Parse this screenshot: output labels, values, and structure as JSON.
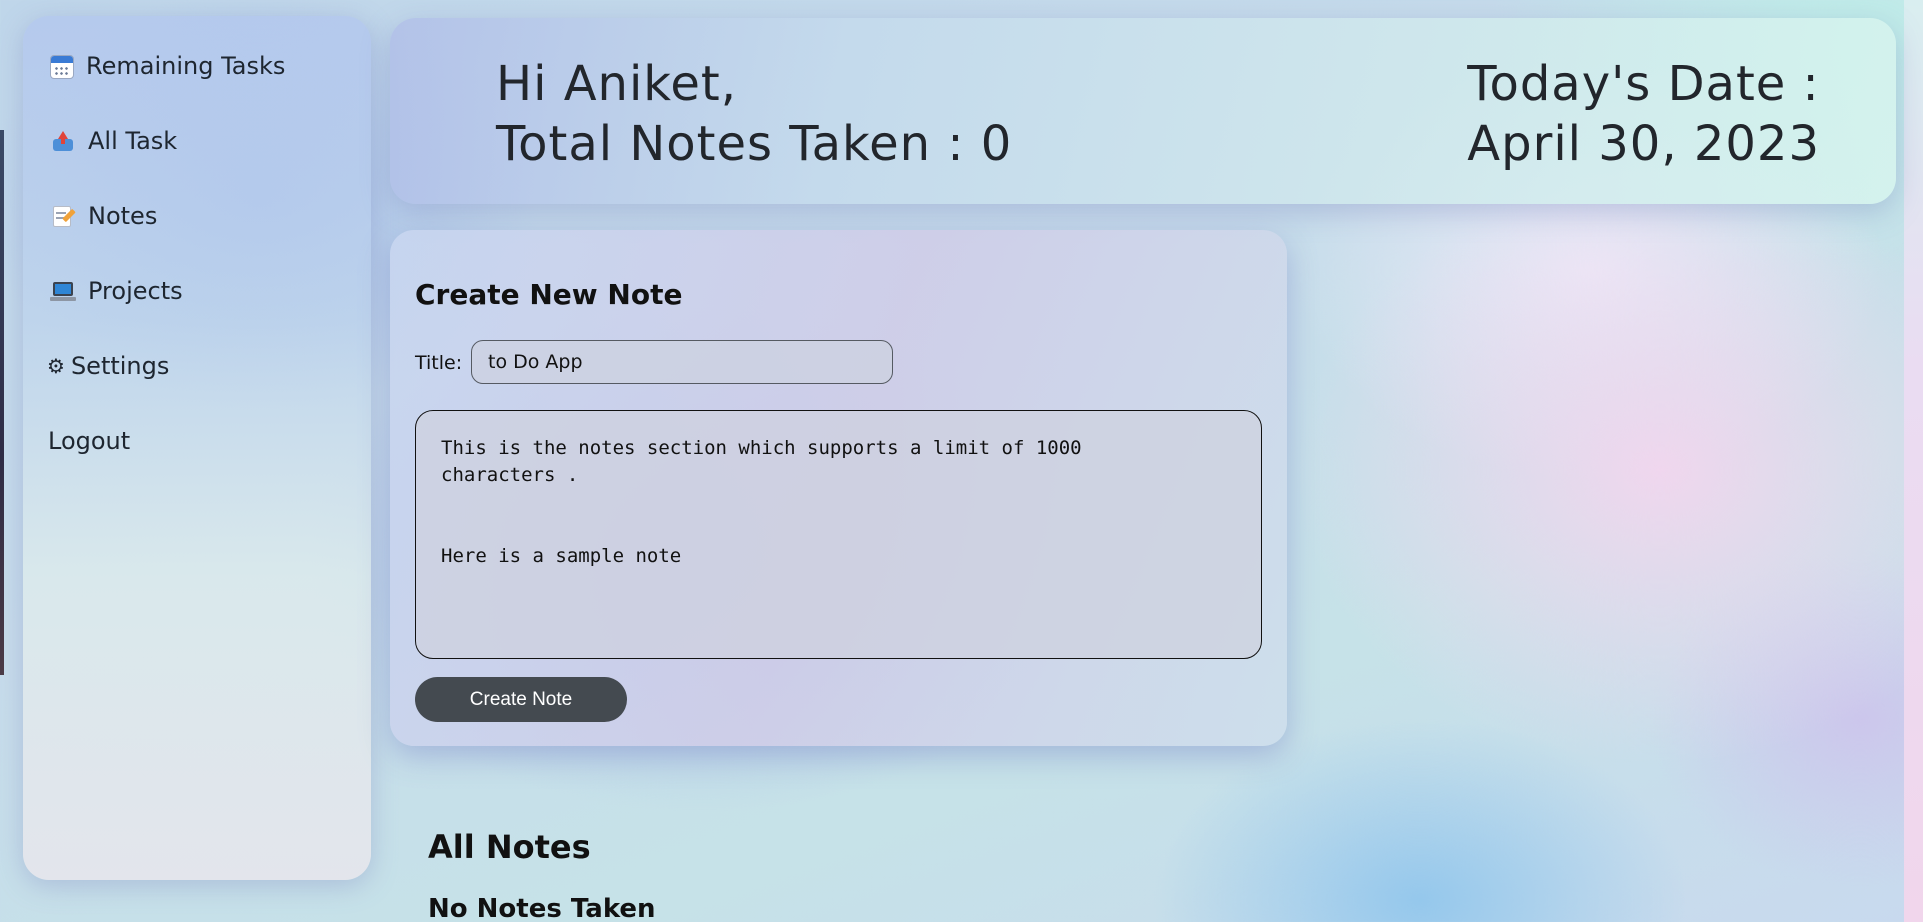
{
  "sidebar": {
    "items": [
      {
        "label": "Remaining Tasks",
        "icon": "calendar-icon"
      },
      {
        "label": "All Task",
        "icon": "inbox-tray-icon"
      },
      {
        "label": "Notes",
        "icon": "memo-icon"
      },
      {
        "label": "Projects",
        "icon": "laptop-icon"
      },
      {
        "label": "Settings",
        "icon": "gear-icon",
        "glyph": "⚙"
      },
      {
        "label": "Logout"
      }
    ]
  },
  "header": {
    "greeting": "Hi Aniket,",
    "total_notes": "Total Notes Taken : 0",
    "date_label": "Today's Date :",
    "date_value": "April 30, 2023"
  },
  "create_note": {
    "heading": "Create New Note",
    "title_label": "Title:",
    "title_value": "to Do App",
    "note_value": "This is the notes section which supports a limit of 1000\ncharacters .\n\n\nHere is a sample note",
    "button_label": "Create Note"
  },
  "all_notes": {
    "heading": "All Notes",
    "empty_message": "No Notes Taken"
  },
  "colors": {
    "button_bg": "#444a50",
    "text": "#22262c"
  }
}
